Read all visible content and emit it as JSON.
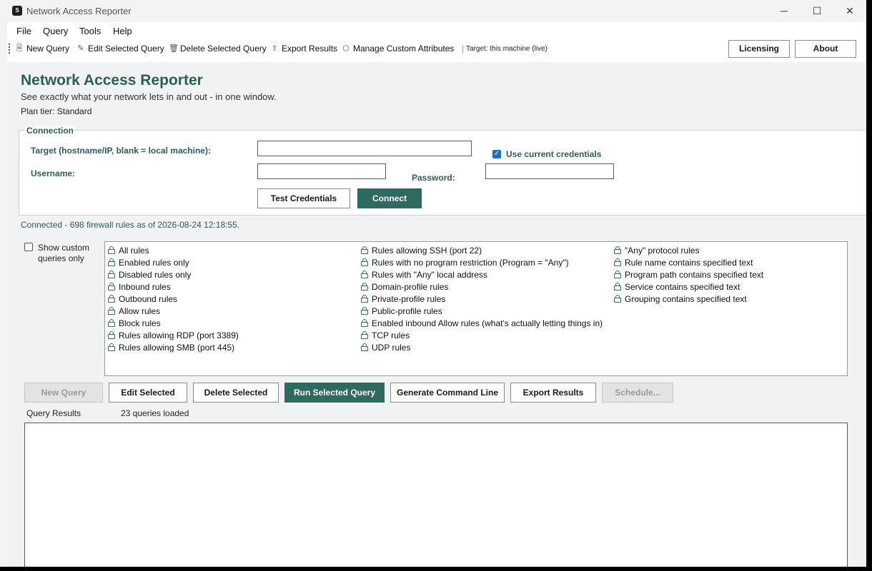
{
  "window": {
    "title": "Network Access Reporter",
    "icon_text": "S",
    "controls": {
      "minimize": "─",
      "maximize": "☐",
      "close": "✕"
    }
  },
  "menu": [
    "File",
    "Query",
    "Tools",
    "Help"
  ],
  "toolbar": {
    "new_query": "New Query",
    "edit_selected_query": "Edit Selected Query",
    "delete_selected_query": "Delete Selected Query",
    "export_results": "Export Results",
    "manage_custom_attributes": "Manage Custom Attributes",
    "target": "Target: this machine (live)",
    "licensing": "Licensing",
    "about": "About"
  },
  "header": {
    "title": "Network Access Reporter",
    "subtitle": "See exactly what your network lets in and out - in one window.",
    "plan": "Plan tier: Standard"
  },
  "connection": {
    "legend": "Connection",
    "target_label": "Target (hostname/IP, blank = local machine):",
    "target_value": "",
    "use_current_credentials": "Use current credentials",
    "use_current_credentials_checked": true,
    "username_label": "Username:",
    "username_value": "",
    "password_label": "Password:",
    "password_value": "",
    "test_credentials": "Test Credentials",
    "connect": "Connect"
  },
  "status": "Connected - 698 firewall rules as of 2026-08-24 12:18:55.",
  "show_custom_only": {
    "label": "Show custom queries only",
    "checked": false
  },
  "queries": {
    "col1": [
      "All rules",
      "Enabled rules only",
      "Disabled rules only",
      "Inbound rules",
      "Outbound rules",
      "Allow rules",
      "Block rules",
      "Rules allowing RDP (port 3389)",
      "Rules allowing SMB (port 445)"
    ],
    "col2": [
      "Rules allowing SSH (port 22)",
      "Rules with no program restriction (Program = \"Any\")",
      "Rules with \"Any\" local address",
      "Domain-profile rules",
      "Private-profile rules",
      "Public-profile rules",
      "Enabled inbound Allow rules (what's actually letting things in)",
      "TCP rules",
      "UDP rules"
    ],
    "col3": [
      "\"Any\" protocol rules",
      "Rule name contains specified text",
      "Program path contains specified text",
      "Service contains specified text",
      "Grouping contains specified text"
    ]
  },
  "actions": {
    "new_query": "New Query",
    "edit_selected": "Edit Selected",
    "delete_selected": "Delete Selected",
    "run_selected_query": "Run Selected Query",
    "generate_command_line": "Generate Command Line",
    "export_results": "Export Results",
    "schedule": "Schedule..."
  },
  "results": {
    "label": "Query Results",
    "count": "23 queries loaded"
  },
  "colors": {
    "accent": "#2e6a5f",
    "heading": "#2e5e57",
    "checkbox": "#1f6fbf"
  }
}
